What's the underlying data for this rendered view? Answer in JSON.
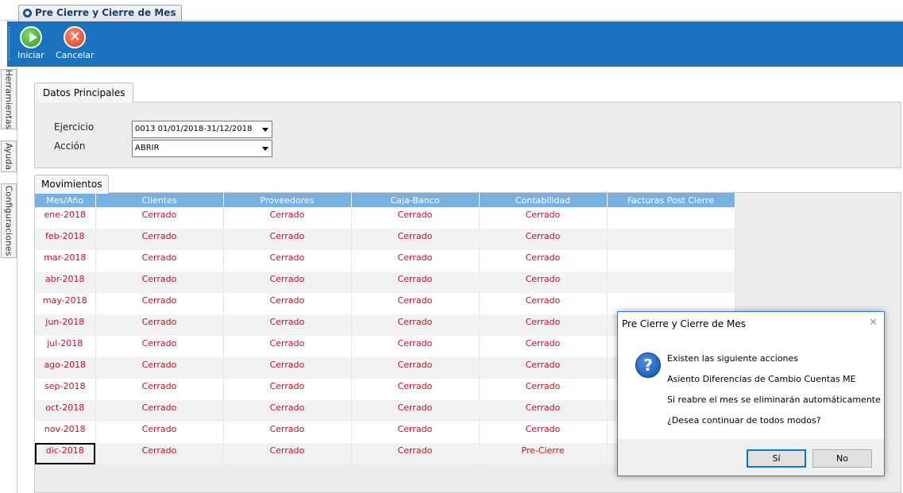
{
  "window": {
    "tab_title": "Pre Cierre y Cierre de Mes"
  },
  "toolbar": {
    "start_label": "Iniciar",
    "cancel_label": "Cancelar"
  },
  "sidebar": {
    "tabs": [
      {
        "label": "Herramientas"
      },
      {
        "label": "Ayuda"
      },
      {
        "label": "Configuraciones"
      }
    ]
  },
  "datos": {
    "tab_label": "Datos Principales",
    "ejercicio_label": "Ejercicio",
    "ejercicio_value": "0013 01/01/2018-31/12/2018",
    "accion_label": "Acción",
    "accion_value": "ABRIR"
  },
  "movimientos": {
    "tab_label": "Movimientos",
    "columns": [
      "Mes/Año",
      "Clientes",
      "Proveedores",
      "Caja-Banco",
      "Contabilidad",
      "Facturas Post Cierre"
    ],
    "rows": [
      [
        "ene-2018",
        "Cerrado",
        "Cerrado",
        "Cerrado",
        "Cerrado",
        ""
      ],
      [
        "feb-2018",
        "Cerrado",
        "Cerrado",
        "Cerrado",
        "Cerrado",
        ""
      ],
      [
        "mar-2018",
        "Cerrado",
        "Cerrado",
        "Cerrado",
        "Cerrado",
        ""
      ],
      [
        "abr-2018",
        "Cerrado",
        "Cerrado",
        "Cerrado",
        "Cerrado",
        ""
      ],
      [
        "may-2018",
        "Cerrado",
        "Cerrado",
        "Cerrado",
        "Cerrado",
        ""
      ],
      [
        "jun-2018",
        "Cerrado",
        "Cerrado",
        "Cerrado",
        "Cerrado",
        ""
      ],
      [
        "jul-2018",
        "Cerrado",
        "Cerrado",
        "Cerrado",
        "Cerrado",
        ""
      ],
      [
        "ago-2018",
        "Cerrado",
        "Cerrado",
        "Cerrado",
        "Cerrado",
        ""
      ],
      [
        "sep-2018",
        "Cerrado",
        "Cerrado",
        "Cerrado",
        "Cerrado",
        ""
      ],
      [
        "oct-2018",
        "Cerrado",
        "Cerrado",
        "Cerrado",
        "Cerrado",
        ""
      ],
      [
        "nov-2018",
        "Cerrado",
        "Cerrado",
        "Cerrado",
        "Cerrado",
        ""
      ],
      [
        "dic-2018",
        "Cerrado",
        "Cerrado",
        "Cerrado",
        "Pre-Cierre",
        ""
      ]
    ]
  },
  "dialog": {
    "title": "Pre Cierre y Cierre de Mes",
    "close_symbol": "✕",
    "icon_symbol": "?",
    "lines": [
      "Existen las siguiente acciones",
      "Asiento Diferencias de Cambio Cuentas ME",
      "Si reabre el mes se eliminarán automáticamente",
      "¿Desea continuar de todos modos?"
    ],
    "yes_label": "Sí",
    "no_label": "No"
  },
  "icons": {
    "start": "play-icon",
    "cancel": "cancel-icon",
    "question": "question-icon"
  },
  "colors": {
    "toolbar": "#1c73bd",
    "grid_header": "#78b0e0",
    "status_text": "#c0102a"
  }
}
